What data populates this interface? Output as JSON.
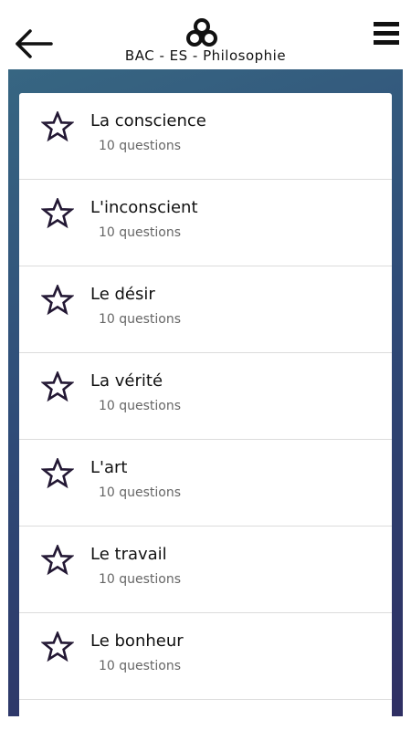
{
  "header": {
    "title": "BAC - ES - Philosophie",
    "back_icon": "arrow-left-icon",
    "logo_icon": "app-logo",
    "menu_icon": "hamburger-menu-icon"
  },
  "colors": {
    "panel_gradient_start": "#376682",
    "panel_gradient_end": "#2f2f63",
    "star_outline": "#221733"
  },
  "topics": [
    {
      "title": "La conscience",
      "count": "10 questions",
      "icon": "star-outline-icon"
    },
    {
      "title": "L'inconscient",
      "count": "10 questions",
      "icon": "star-outline-icon"
    },
    {
      "title": "Le désir",
      "count": "10 questions",
      "icon": "star-outline-icon"
    },
    {
      "title": "La vérité",
      "count": "10 questions",
      "icon": "star-outline-icon"
    },
    {
      "title": "L'art",
      "count": "10 questions",
      "icon": "star-outline-icon"
    },
    {
      "title": "Le travail",
      "count": "10 questions",
      "icon": "star-outline-icon"
    },
    {
      "title": "Le bonheur",
      "count": "10 questions",
      "icon": "star-outline-icon"
    }
  ]
}
